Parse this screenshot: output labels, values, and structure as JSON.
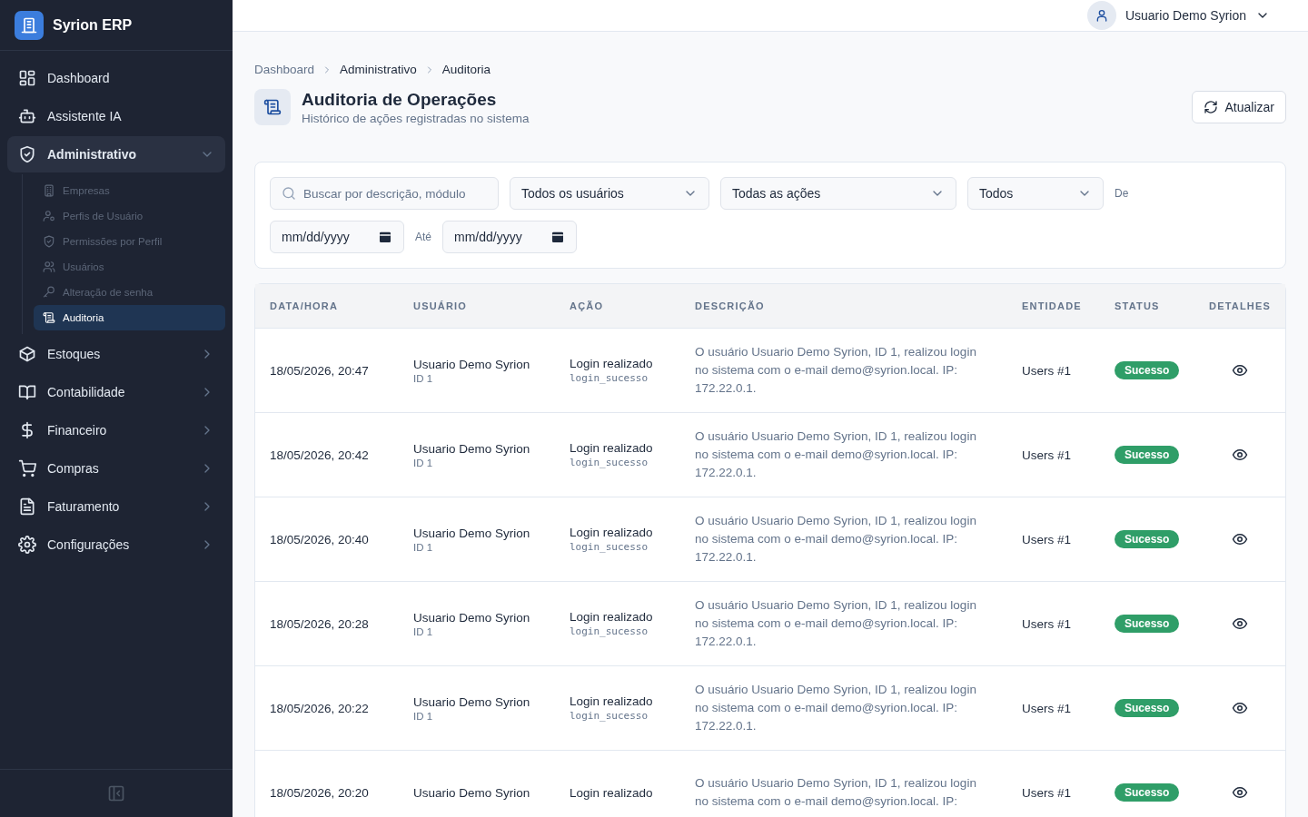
{
  "brand": {
    "name": "Syrion ERP"
  },
  "sidebar": {
    "items": [
      {
        "kind": "link",
        "label": "Dashboard"
      },
      {
        "kind": "link",
        "label": "Assistente IA"
      },
      {
        "kind": "group",
        "label": "Administrativo",
        "expanded": true,
        "children": [
          {
            "label": "Empresas",
            "selected": false
          },
          {
            "label": "Perfis de Usuário",
            "selected": false
          },
          {
            "label": "Permissões por Perfil",
            "selected": false
          },
          {
            "label": "Usuários",
            "selected": false
          },
          {
            "label": "Alteração de senha",
            "selected": false
          },
          {
            "label": "Auditoria",
            "selected": true
          }
        ]
      },
      {
        "kind": "group",
        "label": "Estoques",
        "expanded": false
      },
      {
        "kind": "group",
        "label": "Contabilidade",
        "expanded": false
      },
      {
        "kind": "group",
        "label": "Financeiro",
        "expanded": false
      },
      {
        "kind": "group",
        "label": "Compras",
        "expanded": false
      },
      {
        "kind": "group",
        "label": "Faturamento",
        "expanded": false
      },
      {
        "kind": "group",
        "label": "Configurações",
        "expanded": false
      }
    ]
  },
  "topbar": {
    "user": "Usuario Demo Syrion"
  },
  "breadcrumb": [
    "Dashboard",
    "Administrativo",
    "Auditoria"
  ],
  "header": {
    "title": "Auditoria de Operações",
    "subtitle": "Histórico de ações registradas no sistema",
    "refresh_button": "Atualizar"
  },
  "filters": {
    "search": {
      "placeholder": "Buscar por descrição, módulo"
    },
    "selects": [
      "Todos os usuários",
      "Todas as ações",
      "Todos"
    ],
    "date_from": {
      "label": "De",
      "placeholder": "mm/dd/yyyy"
    },
    "date_to": {
      "label": "Até",
      "placeholder": "mm/dd/yyyy"
    }
  },
  "table": {
    "columns": [
      "DATA/HORA",
      "USUÁRIO",
      "AÇÃO",
      "DESCRIÇÃO",
      "ENTIDADE",
      "STATUS",
      "DETALHES"
    ],
    "rows": [
      {
        "datetime": "18/05/2026, 20:47",
        "user": "Usuario Demo Syrion",
        "user_id": "ID 1",
        "action": "Login realizado",
        "action_code": "login_sucesso",
        "description": "O usuário Usuario Demo Syrion, ID 1, realizou login no sistema com o e-mail demo@syrion.local. IP: 172.22.0.1.",
        "entity": "Users #1",
        "status": "Sucesso"
      },
      {
        "datetime": "18/05/2026, 20:42",
        "user": "Usuario Demo Syrion",
        "user_id": "ID 1",
        "action": "Login realizado",
        "action_code": "login_sucesso",
        "description": "O usuário Usuario Demo Syrion, ID 1, realizou login no sistema com o e-mail demo@syrion.local. IP: 172.22.0.1.",
        "entity": "Users #1",
        "status": "Sucesso"
      },
      {
        "datetime": "18/05/2026, 20:40",
        "user": "Usuario Demo Syrion",
        "user_id": "ID 1",
        "action": "Login realizado",
        "action_code": "login_sucesso",
        "description": "O usuário Usuario Demo Syrion, ID 1, realizou login no sistema com o e-mail demo@syrion.local. IP: 172.22.0.1.",
        "entity": "Users #1",
        "status": "Sucesso"
      },
      {
        "datetime": "18/05/2026, 20:28",
        "user": "Usuario Demo Syrion",
        "user_id": "ID 1",
        "action": "Login realizado",
        "action_code": "login_sucesso",
        "description": "O usuário Usuario Demo Syrion, ID 1, realizou login no sistema com o e-mail demo@syrion.local. IP: 172.22.0.1.",
        "entity": "Users #1",
        "status": "Sucesso"
      },
      {
        "datetime": "18/05/2026, 20:22",
        "user": "Usuario Demo Syrion",
        "user_id": "ID 1",
        "action": "Login realizado",
        "action_code": "login_sucesso",
        "description": "O usuário Usuario Demo Syrion, ID 1, realizou login no sistema com o e-mail demo@syrion.local. IP: 172.22.0.1.",
        "entity": "Users #1",
        "status": "Sucesso"
      },
      {
        "datetime": "18/05/2026, 20:20",
        "user": "Usuario Demo Syrion",
        "action": "Login realizado",
        "description": "O usuário Usuario Demo Syrion, ID 1, realizou login no sistema com o e-mail demo@syrion.local. IP:",
        "entity": "Users #1",
        "status": "Sucesso"
      }
    ]
  }
}
